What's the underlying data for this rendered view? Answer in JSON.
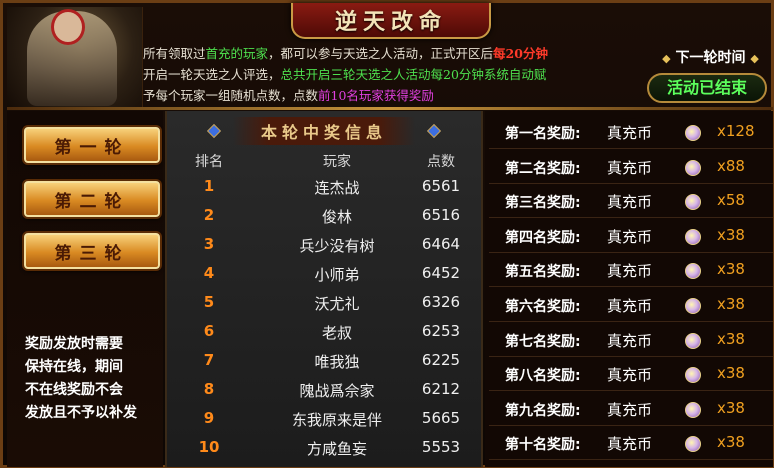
{
  "title": "逆天改命",
  "intro": {
    "p1": "所有领取过",
    "p2": "首充的玩家",
    "p3": "，都可以参与天选之人活动，正式开区后",
    "p4": "每20分钟",
    "p5": "开启一轮天选之人评选，",
    "p6": "总共开启三轮天选之人活动每20分钟系统自动赋",
    "p7": "予每个玩家一组随机点数，点数",
    "p8": "前10名玩家获得奖励"
  },
  "next_round_label": "下一轮时间",
  "status_button": "活动已结束",
  "rounds": [
    "第一轮",
    "第二轮",
    "第三轮"
  ],
  "notice": [
    "奖励发放时需要",
    "保持在线，期间",
    "不在线奖励不会",
    "发放且不予以补发"
  ],
  "table": {
    "title": "本轮中奖信息",
    "headers": [
      "排名",
      "玩家",
      "点数"
    ],
    "rows": [
      {
        "rank": "1",
        "player": "连杰战",
        "points": "6561"
      },
      {
        "rank": "2",
        "player": "俊林",
        "points": "6516"
      },
      {
        "rank": "3",
        "player": "兵少没有树",
        "points": "6464"
      },
      {
        "rank": "4",
        "player": "小师弟",
        "points": "6452"
      },
      {
        "rank": "5",
        "player": "沃尤礼",
        "points": "6326"
      },
      {
        "rank": "6",
        "player": "老叔",
        "points": "6253"
      },
      {
        "rank": "7",
        "player": "唯我独",
        "points": "6225"
      },
      {
        "rank": "8",
        "player": "隗战爲佘家",
        "points": "6212"
      },
      {
        "rank": "9",
        "player": "东我原来是伴",
        "points": "5665"
      },
      {
        "rank": "10",
        "player": "方咸鱼妄",
        "points": "5553"
      }
    ]
  },
  "rewards": [
    {
      "label": "第一名奖励:",
      "item": "真充币",
      "qty": "x128"
    },
    {
      "label": "第二名奖励:",
      "item": "真充币",
      "qty": "x88"
    },
    {
      "label": "第三名奖励:",
      "item": "真充币",
      "qty": "x58"
    },
    {
      "label": "第四名奖励:",
      "item": "真充币",
      "qty": "x38"
    },
    {
      "label": "第五名奖励:",
      "item": "真充币",
      "qty": "x38"
    },
    {
      "label": "第六名奖励:",
      "item": "真充币",
      "qty": "x38"
    },
    {
      "label": "第七名奖励:",
      "item": "真充币",
      "qty": "x38"
    },
    {
      "label": "第八名奖励:",
      "item": "真充币",
      "qty": "x38"
    },
    {
      "label": "第九名奖励:",
      "item": "真充币",
      "qty": "x38"
    },
    {
      "label": "第十名奖励:",
      "item": "真充币",
      "qty": "x38"
    }
  ],
  "colors": {
    "accent": "#ff3a2a",
    "green": "#4ee04e",
    "pink": "#e040e0",
    "gold": "#f0a020"
  }
}
